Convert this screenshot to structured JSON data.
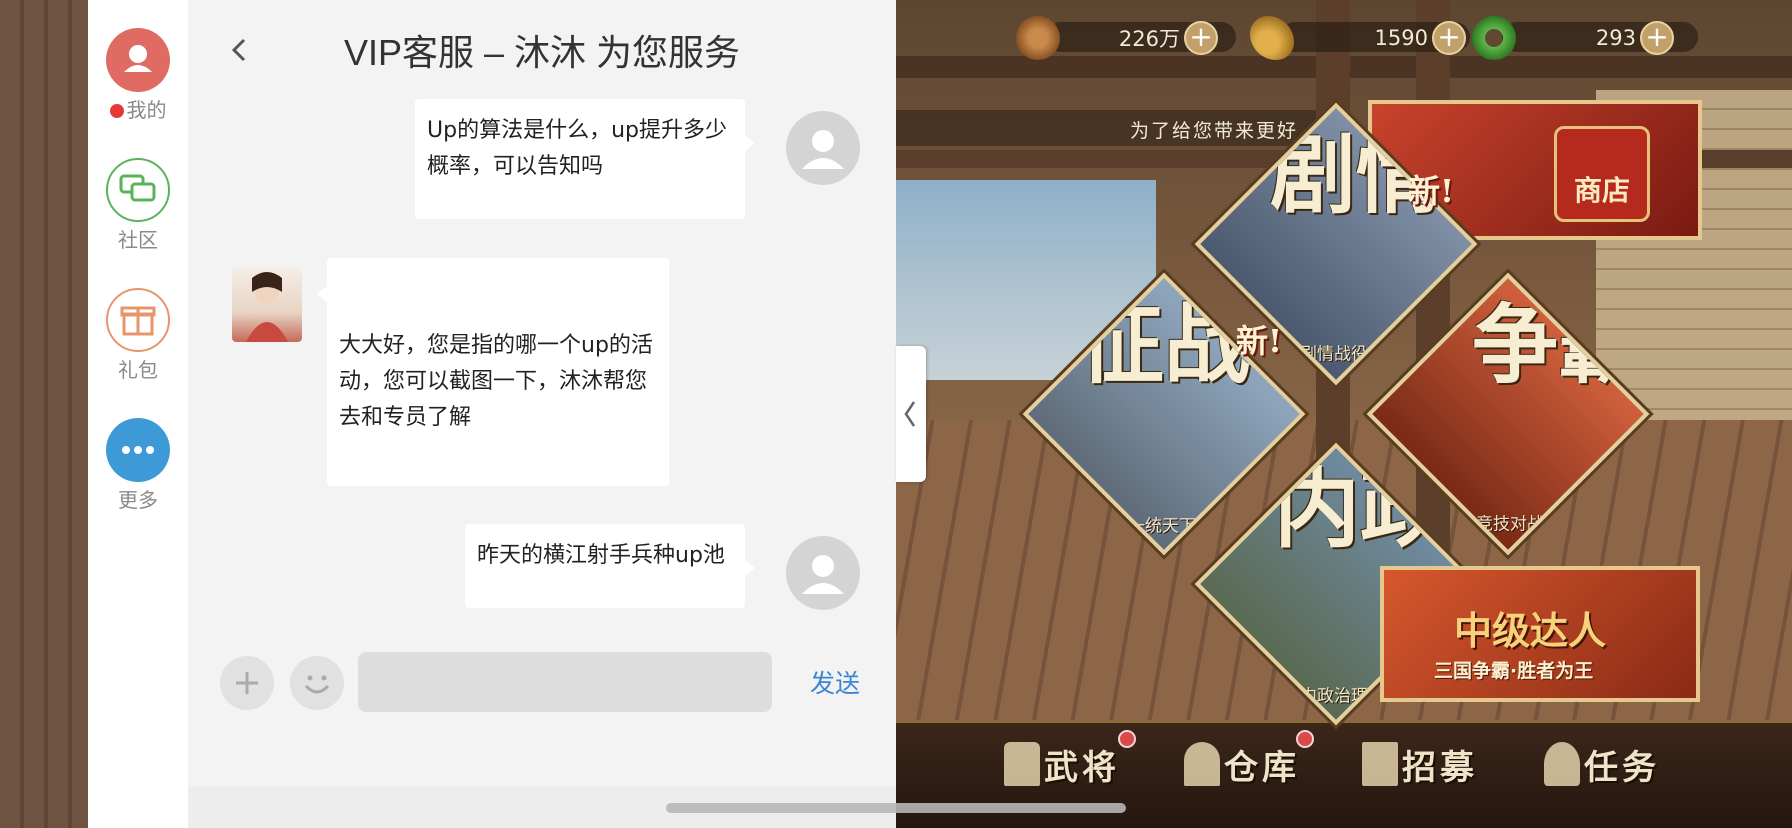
{
  "sidebar": {
    "items": [
      {
        "label": "我的",
        "icon": "person-icon",
        "color": "#e06b62",
        "has_unread": true
      },
      {
        "label": "社区",
        "icon": "chat-bubbles-icon",
        "color": "#5ab35a"
      },
      {
        "label": "礼包",
        "icon": "gift-icon",
        "color": "#e8956c"
      },
      {
        "label": "更多",
        "icon": "more-dots-icon",
        "color": "#3d9ad6"
      }
    ]
  },
  "chat": {
    "title": "VIP客服 – 沐沐 为您服务",
    "messages": [
      {
        "from": "user",
        "text": "Up的算法是什么，up提升多少概率，可以告知吗"
      },
      {
        "from": "agent",
        "text": "大大好，您是指的哪一个up的活动，您可以截图一下，沐沐帮您去和专员了解"
      },
      {
        "from": "user",
        "text": "昨天的横江射手兵种up池"
      }
    ],
    "input": {
      "value": "",
      "placeholder": ""
    },
    "send_label": "发送"
  },
  "game": {
    "resources": [
      {
        "icon": "copper-coin-icon",
        "value": "226万"
      },
      {
        "icon": "wheat-icon",
        "value": "1590"
      },
      {
        "icon": "jade-icon",
        "value": "293"
      }
    ],
    "notice": "为了给您带来更好",
    "tiles": [
      {
        "title": "剧情",
        "subtitle": "剧情战役",
        "new": "新!"
      },
      {
        "title": "征战",
        "subtitle": "一统天下",
        "new": "新!"
      },
      {
        "title": "争霸",
        "subtitle": "竞技对战"
      },
      {
        "title": "内政",
        "subtitle": "内政治理"
      }
    ],
    "shop_label": "商店",
    "promo": {
      "title": "中级达人",
      "subtitle": "三国争霸·胜者为王"
    },
    "bottom_nav": [
      {
        "label": "武将",
        "icon": "helmet-icon",
        "badge": true
      },
      {
        "label": "仓库",
        "icon": "warehouse-icon",
        "badge": true
      },
      {
        "label": "招募",
        "icon": "banner-icon",
        "badge": false
      },
      {
        "label": "任务",
        "icon": "task-icon",
        "badge": false
      }
    ]
  },
  "colors": {
    "accent_blue": "#3a86d6",
    "unread_red": "#e53935",
    "chat_bg": "#f3f3f3"
  }
}
